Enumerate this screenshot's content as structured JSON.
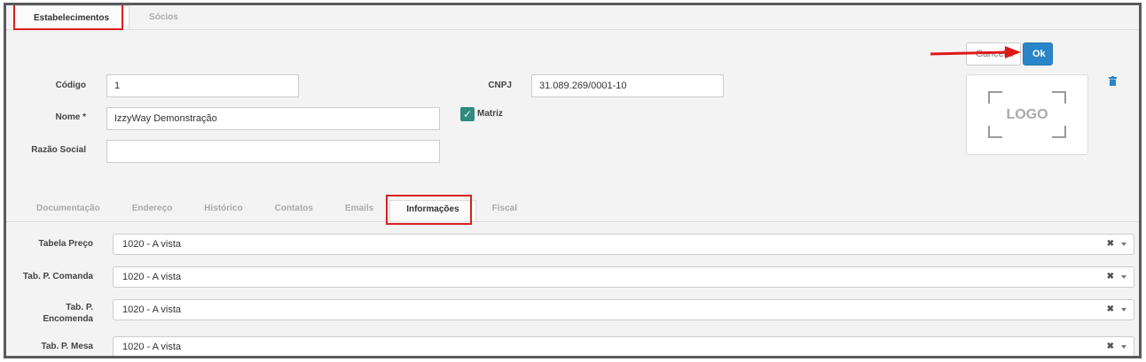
{
  "top_tabs": [
    {
      "label": "Estabelecimentos"
    },
    {
      "label": "Sócios"
    }
  ],
  "buttons": {
    "cancel_label": "Cancelar",
    "ok_label": "Ok"
  },
  "form": {
    "codigo_label": "Código",
    "codigo_value": "1",
    "nome_label": "Nome *",
    "nome_value": "IzzyWay Demonstração",
    "razao_label": "Razão Social",
    "razao_value": "",
    "cnpj_label": "CNPJ",
    "cnpj_value": "31.089.269/0001-10",
    "matriz_label": "Matriz",
    "matriz_checked": true
  },
  "logo": {
    "text": "LOGO"
  },
  "section_tabs": [
    {
      "label": "Documentação"
    },
    {
      "label": "Endereço"
    },
    {
      "label": "Histórico"
    },
    {
      "label": "Contatos"
    },
    {
      "label": "Emails"
    },
    {
      "label": "Informações"
    },
    {
      "label": "Fiscal"
    }
  ],
  "fields": [
    {
      "label": "Tabela Preço",
      "value": "1020 - A vista"
    },
    {
      "label": "Tab. P. Comanda",
      "value": "1020 - A vista"
    },
    {
      "label": "Tab. P. Encomenda",
      "value": "1020 - A vista"
    },
    {
      "label": "Tab. P. Mesa",
      "value": "1020 - A vista"
    }
  ],
  "colors": {
    "accent": "#2a85c8",
    "highlight": "#d82020",
    "check": "#2e8b7d"
  },
  "icons": {
    "trash": "trash-icon",
    "check": "check-icon",
    "caret": "chevron-down-icon",
    "clear": "close-icon"
  }
}
